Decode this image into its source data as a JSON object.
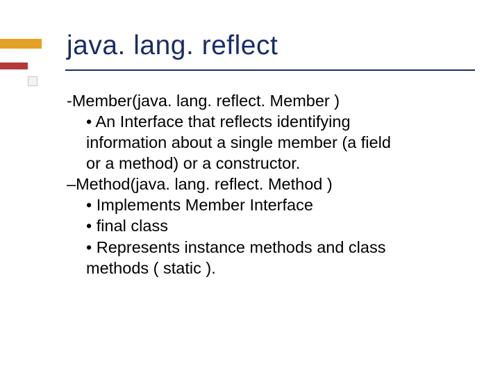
{
  "title": "java. lang. reflect",
  "items": {
    "member_heading": "-Member(java. lang. reflect. Member )",
    "member_bullet1a": "An Interface that reflects identifying",
    "member_bullet1b": "information about a single member (a field",
    "member_bullet1c": "or a method) or a constructor.",
    "method_heading": "–Method(java. lang. reflect. Method )",
    "method_bullet1": "Implements Member Interface",
    "method_bullet2": "final class",
    "method_bullet3a": "Represents instance methods and class",
    "method_bullet3b": "methods ( static )."
  }
}
